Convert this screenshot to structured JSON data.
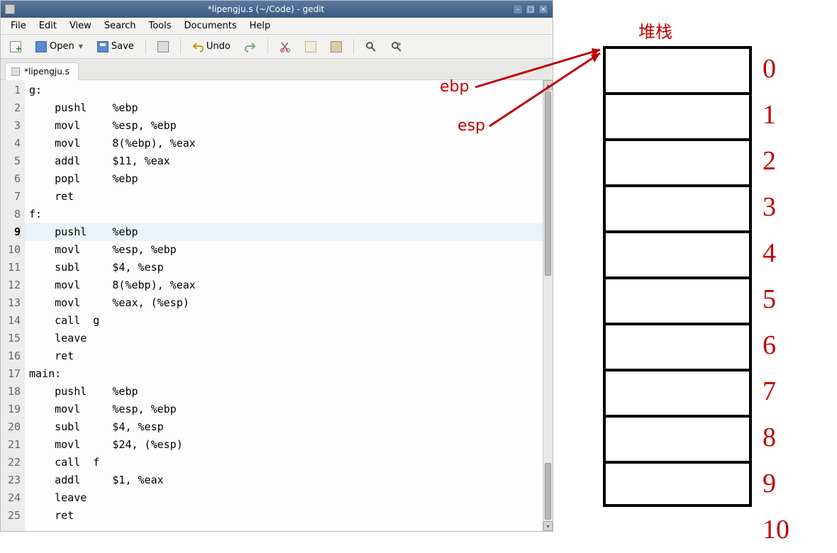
{
  "titlebar": {
    "title": "*lipengju.s (~/Code) - gedit"
  },
  "menubar": {
    "file": "File",
    "edit": "Edit",
    "view": "View",
    "search": "Search",
    "tools": "Tools",
    "documents": "Documents",
    "help": "Help"
  },
  "toolbar": {
    "open": "Open",
    "save": "Save",
    "undo": "Undo"
  },
  "tab": {
    "label": "*lipengju.s"
  },
  "code": {
    "lines": [
      {
        "num": "1",
        "text": "g:"
      },
      {
        "num": "2",
        "text": "    pushl    %ebp"
      },
      {
        "num": "3",
        "text": "    movl     %esp, %ebp"
      },
      {
        "num": "4",
        "text": "    movl     8(%ebp), %eax"
      },
      {
        "num": "5",
        "text": "    addl     $11, %eax"
      },
      {
        "num": "6",
        "text": "    popl     %ebp"
      },
      {
        "num": "7",
        "text": "    ret"
      },
      {
        "num": "8",
        "text": "f:"
      },
      {
        "num": "9",
        "text": "    pushl    %ebp",
        "hl": true,
        "bold": true
      },
      {
        "num": "10",
        "text": "    movl     %esp, %ebp"
      },
      {
        "num": "11",
        "text": "    subl     $4, %esp"
      },
      {
        "num": "12",
        "text": "    movl     8(%ebp), %eax"
      },
      {
        "num": "13",
        "text": "    movl     %eax, (%esp)"
      },
      {
        "num": "14",
        "text": "    call  g"
      },
      {
        "num": "15",
        "text": "    leave"
      },
      {
        "num": "16",
        "text": "    ret"
      },
      {
        "num": "17",
        "text": "main:"
      },
      {
        "num": "18",
        "text": "    pushl    %ebp"
      },
      {
        "num": "19",
        "text": "    movl     %esp, %ebp"
      },
      {
        "num": "20",
        "text": "    subl     $4, %esp"
      },
      {
        "num": "21",
        "text": "    movl     $24, (%esp)"
      },
      {
        "num": "22",
        "text": "    call  f"
      },
      {
        "num": "23",
        "text": "    addl     $1, %eax"
      },
      {
        "num": "24",
        "text": "    leave"
      },
      {
        "num": "25",
        "text": "    ret"
      }
    ]
  },
  "diagram": {
    "title": "堆栈",
    "ebp": "ebp",
    "esp": "esp",
    "numbers": [
      "0",
      "1",
      "2",
      "3",
      "4",
      "5",
      "6",
      "7",
      "8",
      "9",
      "10"
    ]
  }
}
